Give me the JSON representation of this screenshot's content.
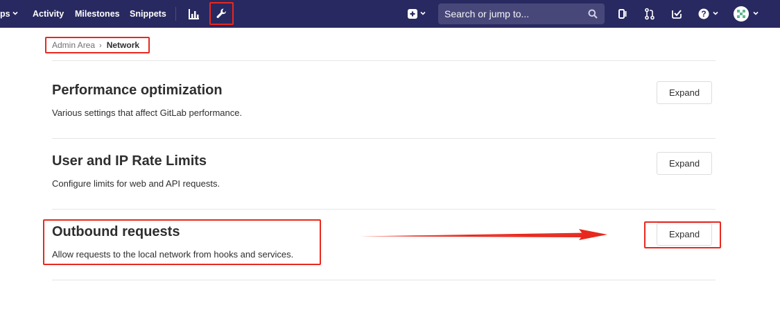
{
  "navbar": {
    "links": [
      {
        "label": "ps"
      },
      {
        "label": "Activity"
      },
      {
        "label": "Milestones"
      },
      {
        "label": "Snippets"
      }
    ],
    "search": {
      "placeholder": "Search or jump to..."
    },
    "icons": [
      "chart-icon",
      "admin-wrench-icon",
      "new-plus-icon",
      "issues-icon",
      "merge-requests-icon",
      "todos-icon",
      "help-icon",
      "avatar"
    ]
  },
  "breadcrumb": {
    "parent": "Admin Area",
    "current": "Network"
  },
  "sections": [
    {
      "title": "Performance optimization",
      "description": "Various settings that affect GitLab performance.",
      "button": "Expand"
    },
    {
      "title": "User and IP Rate Limits",
      "description": "Configure limits for web and API requests.",
      "button": "Expand"
    },
    {
      "title": "Outbound requests",
      "description": "Allow requests to the local network from hooks and services.",
      "button": "Expand"
    }
  ],
  "colors": {
    "navbar": "#292961",
    "search": "#48477a",
    "annotation": "#e8281e"
  }
}
